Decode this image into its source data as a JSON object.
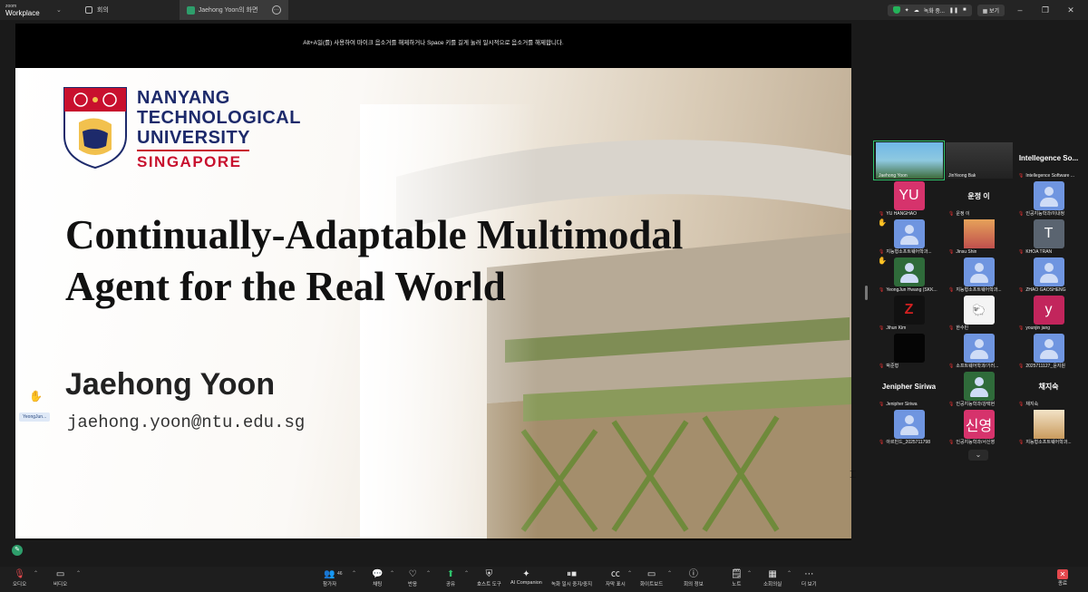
{
  "app": {
    "brand_small": "zoom",
    "brand_big": "Workplace"
  },
  "tabs": [
    {
      "label": "회의"
    },
    {
      "label": "Jaehong Yoon의 화면"
    }
  ],
  "title_right": {
    "recording_label": "녹화 중...",
    "view_label": "보기"
  },
  "stage": {
    "notice": "Alt+A일(를) 사용하여 마이크 음소거를 해제하거나 Space 키를 길게 눌러 일시적으로 음소거를 해제합니다."
  },
  "slide": {
    "university_line1": "NANYANG",
    "university_line2": "TECHNOLOGICAL",
    "university_line3": "UNIVERSITY",
    "university_line4": "SINGAPORE",
    "title_line1": "Continually-Adaptable Multimodal",
    "title_line2": "Agent for the Real World",
    "presenter": "Jaehong Yoon",
    "email": "jaehong.yoon@ntu.edu.sg"
  },
  "floating_tag": "YeongJun...",
  "gallery": [
    {
      "label": "Jaehong Yoon",
      "kind": "video",
      "selected": true
    },
    {
      "label": "JinYeong Bak",
      "kind": "video"
    },
    {
      "label": "Intellegence Software ...",
      "kind": "name",
      "display": "Intellegence So..."
    },
    {
      "label": "YU HANGHAO",
      "kind": "initials",
      "initials": "YU",
      "color": "#d6336c"
    },
    {
      "label": "운정 이",
      "kind": "name",
      "display": "운정 이"
    },
    {
      "label": "인공지능학과/이내정",
      "kind": "person"
    },
    {
      "label": "지능형소프트웨어학과...",
      "kind": "person"
    },
    {
      "label": "Jinsu Shin",
      "kind": "photo"
    },
    {
      "label": "KHOA TRAN",
      "kind": "initials",
      "initials": "T",
      "color": "#5a6470"
    },
    {
      "label": "YeongJun Hwang (SKK...",
      "kind": "person-dark"
    },
    {
      "label": "지능형소프트웨어학과...",
      "kind": "person"
    },
    {
      "label": "ZHAO GAOSHENG",
      "kind": "person"
    },
    {
      "label": "Jihun Kim",
      "kind": "logo-z"
    },
    {
      "label": "한수민",
      "kind": "doodle"
    },
    {
      "label": "younjin jang",
      "kind": "initials",
      "initials": "y",
      "color": "#c2255c"
    },
    {
      "label": "박준형",
      "kind": "black"
    },
    {
      "label": "소프트웨어학과/기러...",
      "kind": "person"
    },
    {
      "label": "2025711127_윤지원",
      "kind": "person"
    },
    {
      "label": "Jenipher Siriwa",
      "kind": "name",
      "display": "Jenipher Siriwa"
    },
    {
      "label": "인공지능학과/강택현",
      "kind": "person-dark"
    },
    {
      "label": "채지숙",
      "kind": "name",
      "display": "채지숙"
    },
    {
      "label": "아르빈드_2025711798",
      "kind": "person"
    },
    {
      "label": "인공지능학과/서신영",
      "kind": "initials",
      "initials": "신영",
      "color": "#d6336c"
    },
    {
      "label": "지능형소프트웨어학과...",
      "kind": "photo2"
    }
  ],
  "toolbar": {
    "audio": "오디오",
    "video": "비디오",
    "participants": "참가자",
    "participants_count": "46",
    "chat": "채팅",
    "react": "반응",
    "share": "공유",
    "host_tools": "호스트 도구",
    "ai_companion": "AI Companion",
    "record": "녹화 일시 중지/중지",
    "captions": "자막 표시",
    "whiteboard": "화이트보드",
    "meeting_info": "회의 정보",
    "notes": "노트",
    "breakout": "소회의실",
    "more": "더 보기",
    "end": "종료"
  },
  "colors": {
    "accent": "#2ec26b",
    "danger": "#e5484d",
    "ntu_navy": "#1d2a6b",
    "ntu_red": "#c8102e"
  }
}
